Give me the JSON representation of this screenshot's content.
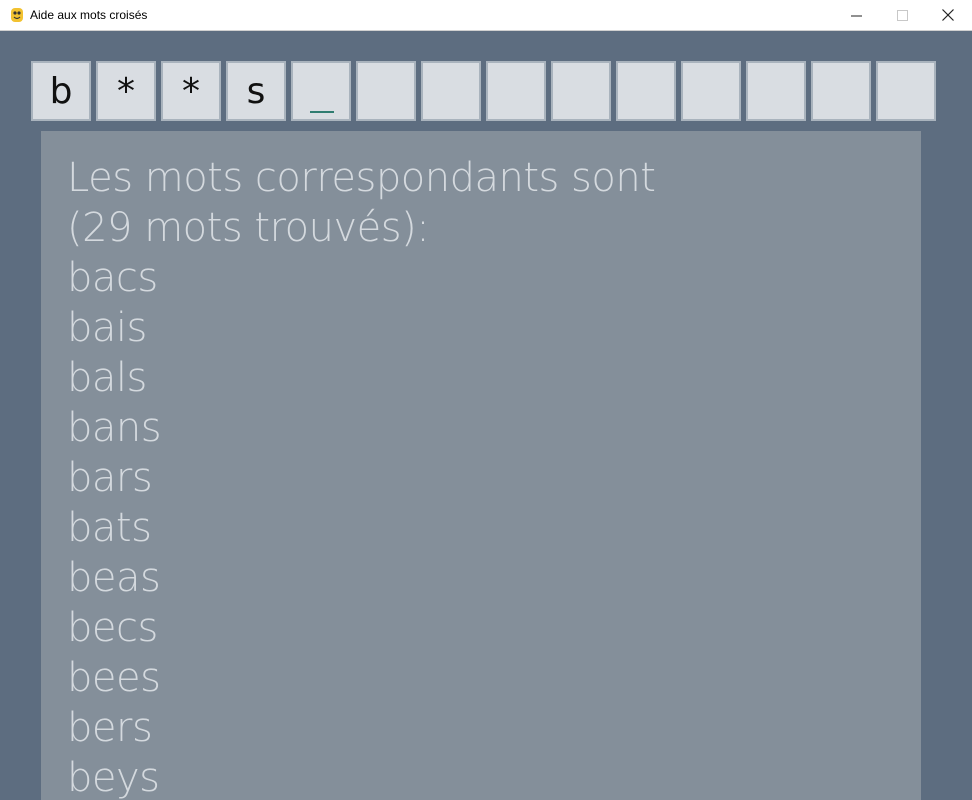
{
  "window": {
    "title": "Aide aux mots croisés",
    "minimize_icon": "minimize-icon",
    "maximize_icon": "maximize-icon",
    "close_icon": "close-icon"
  },
  "pattern": {
    "cells": [
      "b",
      "*",
      "*",
      "s",
      "",
      "",
      "",
      "",
      "",
      "",
      "",
      "",
      "",
      ""
    ],
    "cursor_index": 4
  },
  "results": {
    "header_line1": "Les mots correspondants sont",
    "header_line2": "(29 mots trouvés):",
    "words": [
      "bacs",
      "bais",
      "bals",
      "bans",
      "bars",
      "bats",
      "beas",
      "becs",
      "bees",
      "bers",
      "beys"
    ]
  }
}
